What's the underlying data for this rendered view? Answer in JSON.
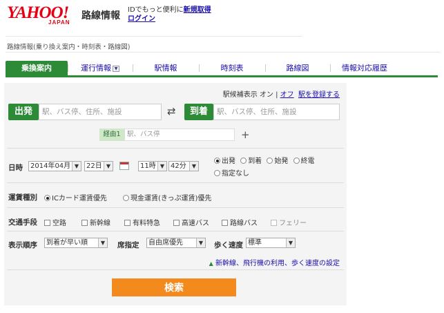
{
  "header": {
    "logo_main": "YAHOO!",
    "logo_sub": "JAPAN",
    "service_name": "路線情報",
    "id_note": "IDでもっと便利に",
    "register_link": "新規取得",
    "login_link": "ログイン"
  },
  "breadcrumb": "路線情報(乗り換え案内・時刻表・路線図)",
  "tabs": [
    {
      "label": "乗換案内",
      "active": true
    },
    {
      "label": "運行情報",
      "active": false
    },
    {
      "label": "駅情報",
      "active": false
    },
    {
      "label": "時刻表",
      "active": false
    },
    {
      "label": "路線図",
      "active": false
    },
    {
      "label": "情報対応履歴",
      "active": false
    }
  ],
  "form": {
    "station_hint": {
      "label": "駅候補表示",
      "on": "オン",
      "sep": "|",
      "off": "オフ"
    },
    "register_station": "駅を登録する",
    "from_label": "出発",
    "from_placeholder": "駅、バス停、住所、施設",
    "to_label": "到着",
    "to_placeholder": "駅、バス停、住所、施設",
    "via_label": "経由1",
    "via_placeholder": "駅、バス停",
    "date_label": "日時",
    "year_month": "2014年04月",
    "day": "22日",
    "hour": "11時",
    "minute": "42分",
    "time_options": [
      "出発",
      "到着",
      "始発",
      "終電",
      "指定なし"
    ],
    "fare_label": "運賃種別",
    "fare_options": [
      "ICカード運賃優先",
      "現金運賃(きっぷ運賃)優先"
    ],
    "transport_label": "交通手段",
    "transport_options": [
      "空路",
      "新幹線",
      "有料特急",
      "高速バス",
      "路線バス",
      "フェリー"
    ],
    "order_label": "表示順序",
    "order_value": "到着が早い順",
    "seat_label": "席指定",
    "seat_value": "自由席優先",
    "walk_label": "歩く速度",
    "walk_value": "標準",
    "advanced_link": "新幹線、飛行機の利用、歩く速度の設定",
    "search_button": "検索"
  },
  "colors": {
    "brand_green": "#2d8a37",
    "yahoo_red": "#e60012",
    "search_orange": "#f28a1d"
  }
}
